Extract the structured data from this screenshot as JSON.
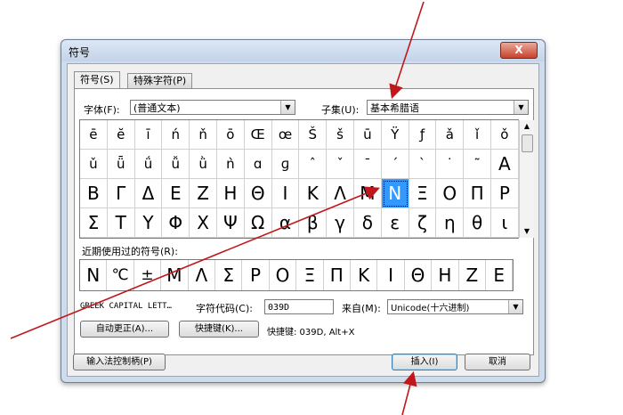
{
  "window": {
    "title": "符号",
    "close_label": "X"
  },
  "tabs": [
    {
      "label": "符号(S)",
      "active": true
    },
    {
      "label": "特殊字符(P)",
      "active": false
    }
  ],
  "font": {
    "label": "字体(F):",
    "value": "(普通文本)"
  },
  "subset": {
    "label": "子集(U):",
    "value": "基本希腊语"
  },
  "symbols": [
    [
      "ē",
      "ĕ",
      "ī",
      "ń",
      "ň",
      "ō",
      "Œ",
      "œ",
      "Š",
      "š",
      "ū",
      "Ÿ",
      "ƒ",
      "ǎ",
      "ǐ",
      "ǒ"
    ],
    [
      "ǔ",
      "ǖ",
      "ǘ",
      "ǚ",
      "ǜ",
      "ǹ",
      "ɑ",
      "ɡ",
      "ˆ",
      "ˇ",
      "ˉ",
      "ˊ",
      "ˋ",
      "˙",
      "˜",
      "Α"
    ],
    [
      "Β",
      "Γ",
      "Δ",
      "Ε",
      "Ζ",
      "Η",
      "Θ",
      "Ι",
      "Κ",
      "Λ",
      "Μ",
      "Ν",
      "Ξ",
      "Ο",
      "Π",
      "Ρ"
    ],
    [
      "Σ",
      "Τ",
      "Υ",
      "Φ",
      "Χ",
      "Ψ",
      "Ω",
      "α",
      "β",
      "γ",
      "δ",
      "ε",
      "ζ",
      "η",
      "θ",
      "ι"
    ]
  ],
  "selected": {
    "row": 2,
    "col": 11
  },
  "recent": {
    "label": "近期使用过的符号(R):",
    "items": [
      "Ν",
      "℃",
      "±",
      "Μ",
      "Λ",
      "Σ",
      "Ρ",
      "Ο",
      "Ξ",
      "Π",
      "Κ",
      "Ι",
      "Θ",
      "Η",
      "Ζ",
      "Ε"
    ]
  },
  "char_name": "GREEK CAPITAL LETT…",
  "char_code": {
    "label": "字符代码(C):",
    "value": "039D"
  },
  "from": {
    "label": "来自(M):",
    "value": "Unicode(十六进制)"
  },
  "buttons": {
    "autocorrect": "自动更正(A)...",
    "shortcut_key": "快捷键(K)...",
    "shortcut_text": "快捷键: 039D, Alt+X",
    "ime": "输入法控制柄(P)",
    "insert": "插入(I)",
    "cancel": "取消"
  },
  "colors": {
    "selection": "#3399ff",
    "annotation": "#c0181a"
  }
}
